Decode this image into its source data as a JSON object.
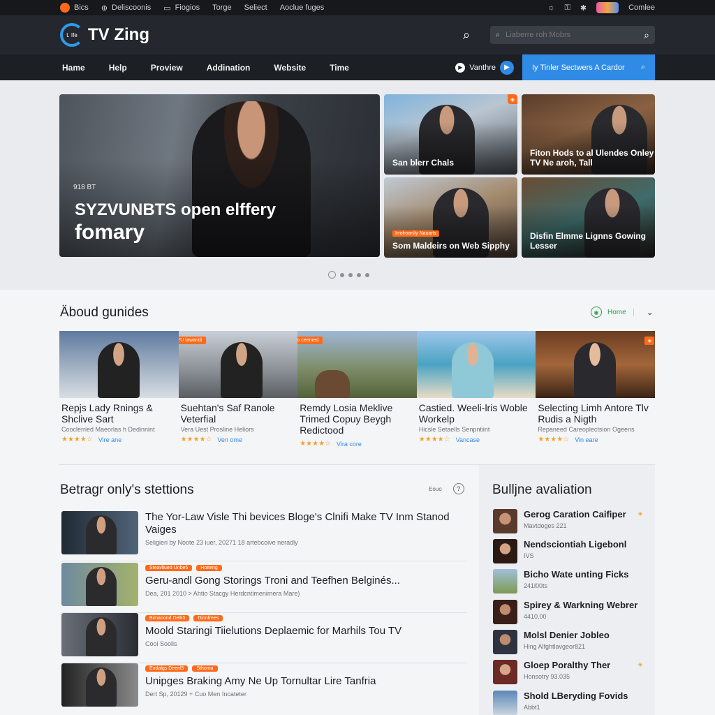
{
  "topbar": {
    "items": [
      "Bics",
      "Deliscoonis",
      "Fiogios",
      "Torge",
      "Seliect",
      "Aoclue fuges"
    ],
    "right_label": "Comlee",
    "icons": [
      "home-icon",
      "clock-icon",
      "screen-icon",
      "sun-icon",
      "lock-icon",
      "gear-icon"
    ]
  },
  "header": {
    "logo_text": "TV Zing",
    "logo_mark": "t. Ife",
    "search_placeholder": "Liaberre roh Mobrs"
  },
  "nav": {
    "items": [
      "Hame",
      "Help",
      "Proview",
      "Addination",
      "Website",
      "Time"
    ],
    "watch_label": "Vanthre",
    "cta_label": "Iy Tinler Sectwers A Cardor"
  },
  "hero": {
    "kicker": "918 BT",
    "title_line1": "SYZVUNBTS open elffery",
    "title_line2": "fomary",
    "tiles": [
      {
        "caption": "San blerr Chals",
        "tag": ""
      },
      {
        "caption": "Fiton Hods to al Ulendes Onley TV Ne aroh, Tall",
        "tag": ""
      },
      {
        "caption": "Som Maldeirs on Web Sipphy",
        "tag": "Irrolroanlly Nauarls"
      },
      {
        "caption": "Disfin Elmme Lignns Gowing Lesser",
        "tag": ""
      }
    ]
  },
  "about": {
    "title": "Äboud gunides",
    "control_label": "Home",
    "cards": [
      {
        "title": "Repjs Lady Rnings & Shclive Sart",
        "meta": "Cooclerried Maeorlas h Dedinnint",
        "stars": "★★★★☆",
        "link": "Vire ane",
        "tag": ""
      },
      {
        "title": "Suehtan's Saf Ranole Veterfial",
        "meta": "Vera Uest Prosline Heliors",
        "stars": "★★★★☆",
        "link": "Ven ome",
        "tag": "EU tawaridi"
      },
      {
        "title": "Remdy Losia Meklive Trimed Copuy Beygh Redictood",
        "meta": "",
        "stars": "★★★★☆",
        "link": "Vira core",
        "tag": "Fo ceemed"
      },
      {
        "title": "Castied. Weeli-lris Woble Workelp",
        "meta": "Hicsle Setaells Senpntiint",
        "stars": "★★★★☆",
        "link": "Vancase",
        "tag": ""
      },
      {
        "title": "Selecting Limh Antore Tlv Rudis a Nigth",
        "meta": "Repaneed Careoplectsion Ogeens",
        "stars": "★★★★☆",
        "link": "Vin eare",
        "tag": ""
      }
    ]
  },
  "stories": {
    "title": "Betragr only's stettions",
    "control_label": "Eouo",
    "items": [
      {
        "title": "The Yor-Law Visle Thi bevices Bloge's Clnifi Make TV Inm Stanod Vaiges",
        "meta": "Seligieri by Noote 23 iuer, 20271 18 artebcoive neradly",
        "tags": []
      },
      {
        "title": "Geru-andl Gong Storings Troni and Teefhen Belginés...",
        "meta": "Dea, 201 2010 > Ahtio Stacgy Herdcntimenimera Mare)",
        "tags": [
          "Steavliued Unbe5",
          "Hotteng"
        ]
      },
      {
        "title": "Moold Staringi Tiielutions Deplaemic for Marhils Tou TV",
        "meta": "Cooi Soolis",
        "tags": [
          "Bimanond Delti5",
          "Dinnfrees"
        ]
      },
      {
        "title": "Unipges Braking Amy Ne Up Tornultar Lire Tanfria",
        "meta": "Dert Sp, 20129 + Cuo Men Incateter",
        "tags": [
          "Eodalgs Deenl5",
          "Sthoma"
        ]
      }
    ]
  },
  "panel": {
    "title": "Bulljne avaliation",
    "items": [
      {
        "name": "Gerog Caration Caifiper",
        "sub": "Mavtdoges 221",
        "mark": "◈"
      },
      {
        "name": "Nendsciontiah Ligebonl",
        "sub": "IVS",
        "mark": ""
      },
      {
        "name": "Bicho Wate unting Ficks",
        "sub": "241l00ts",
        "mark": ""
      },
      {
        "name": "Spirey & Warkning Webrer",
        "sub": "4410.00",
        "mark": ""
      },
      {
        "name": "Molsl Denier Jobleo",
        "sub": "Hing Alfghtlavgeor821",
        "mark": ""
      },
      {
        "name": "Gloep Poralthy Ther",
        "sub": "Honsotry 93.035",
        "mark": "◈"
      },
      {
        "name": "Shold LBerydin͏g Fovids",
        "sub": "Abbt1",
        "mark": ""
      }
    ]
  },
  "colors": {
    "accent_blue": "#2f8be6",
    "accent_orange": "#ff6a1a",
    "header_bg": "#24272d",
    "nav_bg": "#1c1f24"
  }
}
